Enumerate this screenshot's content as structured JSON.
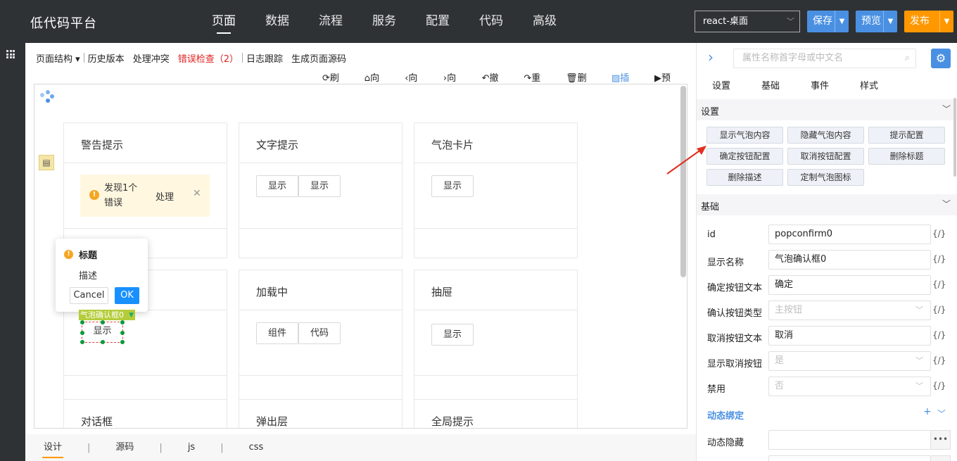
{
  "app": {
    "title": "低代码平台"
  },
  "nav": [
    "页面",
    "数据",
    "流程",
    "服务",
    "配置",
    "代码",
    "高级"
  ],
  "header": {
    "env_select": "react-桌面",
    "save": "保存",
    "preview": "预览",
    "publish": "发布"
  },
  "menu": {
    "page_structure": "页面结构 ▾",
    "history": "历史版本",
    "conflicts": "处理冲突",
    "errors": "错误检查（2）",
    "logs": "日志跟踪",
    "gen_source": "生成页面源码"
  },
  "tools": [
    "刷新",
    "向上",
    "向前",
    "向后",
    "撤销",
    "重做",
    "删除",
    "插图",
    "预览"
  ],
  "cards": {
    "alert": {
      "title": "警告提示",
      "msg": "发现1个错误",
      "action": "处理",
      "close": "✕"
    },
    "text_tip": {
      "title": "文字提示",
      "btn1": "显示",
      "btn2": "显示"
    },
    "bubble_card": {
      "title": "气泡卡片",
      "btn": "显示"
    },
    "loading": {
      "title": "加载中",
      "btn1": "组件",
      "btn2": "代码"
    },
    "drawer": {
      "title": "抽屉",
      "btn": "显示"
    },
    "dialog": {
      "title": "对话框"
    },
    "popup": {
      "title": "弹出层"
    },
    "global_tip": {
      "title": "全局提示"
    },
    "bubble_confirm_btn": "显示"
  },
  "popconfirm": {
    "title": "标题",
    "desc": "描述",
    "cancel": "Cancel",
    "ok": "OK"
  },
  "selection": {
    "tag": "气泡确认框0"
  },
  "bottom_tabs": [
    "设计",
    "源码",
    "js",
    "css"
  ],
  "panel": {
    "search_placeholder": "属性名称首字母或中文名",
    "tabs": [
      "设置",
      "基础",
      "事件",
      "样式"
    ],
    "settings_title": "设置",
    "settings_buttons": [
      "显示气泡内容",
      "隐藏气泡内容",
      "提示配置",
      "确定按钮配置",
      "取消按钮配置",
      "删除标题",
      "删除描述",
      "定制气泡图标"
    ],
    "basic_title": "基础",
    "props": [
      {
        "label": "id",
        "value": "popconfirm0",
        "placeholder": false
      },
      {
        "label": "显示名称",
        "value": "气泡确认框0",
        "placeholder": false
      },
      {
        "label": "确定按钮文本",
        "value": "确定",
        "placeholder": false
      },
      {
        "label": "确认按钮类型",
        "value": "主按钮",
        "placeholder": true
      },
      {
        "label": "取消按钮文本",
        "value": "取消",
        "placeholder": false
      },
      {
        "label": "显示取消按钮",
        "value": "是",
        "placeholder": true
      },
      {
        "label": "禁用",
        "value": "否",
        "placeholder": true
      }
    ],
    "expr": "{/}",
    "dynamic_title": "动态绑定",
    "dynamic_hide": "动态隐藏"
  }
}
